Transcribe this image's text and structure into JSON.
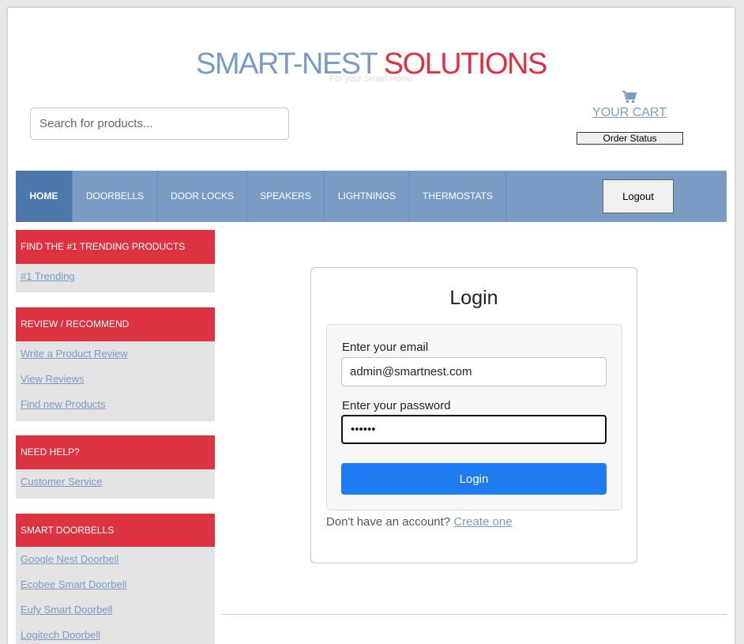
{
  "header": {
    "brand_part1": "SMART-NEST",
    "brand_part2": "SOLUTIONS",
    "tagline": "For your Smart Home",
    "search_placeholder": "Search for products...",
    "cart_label": "YOUR CART",
    "cart_icon": "shopping-cart-icon",
    "order_status_label": "Order Status"
  },
  "nav": {
    "items": [
      {
        "label": "HOME",
        "active": true
      },
      {
        "label": "DOORBELLS"
      },
      {
        "label": "DOOR LOCKS"
      },
      {
        "label": "SPEAKERS"
      },
      {
        "label": "LIGHTNINGS"
      },
      {
        "label": "THERMOSTATS"
      }
    ],
    "logout_label": "Logout"
  },
  "sidebar": {
    "sections": [
      {
        "heading": "FIND THE #1 TRENDING PRODUCTS",
        "links": [
          "#1 Trending"
        ]
      },
      {
        "heading": "REVIEW / RECOMMEND",
        "links": [
          "Write a Product Review",
          "View Reviews",
          "Find new Products"
        ]
      },
      {
        "heading": "NEED HELP?",
        "links": [
          "Customer Service"
        ]
      },
      {
        "heading": "SMART DOORBELLS",
        "links": [
          "Google Nest Doorbell",
          "Ecobee Smart Doorbell",
          "Eufy Smart Doorbell",
          "Logitech Doorbell"
        ]
      }
    ]
  },
  "login": {
    "title": "Login",
    "email_label": "Enter your email",
    "email_value": "admin@smartnest.com",
    "password_label": "Enter your password",
    "password_value": "••••••",
    "button_label": "Login",
    "no_account_text": "Don't have an account?",
    "create_link": "Create one"
  },
  "colors": {
    "brand_blue": "#7a9bc4",
    "brand_red": "#dd3340",
    "nav_active": "#4c77ab",
    "login_button": "#1f7bf2"
  }
}
